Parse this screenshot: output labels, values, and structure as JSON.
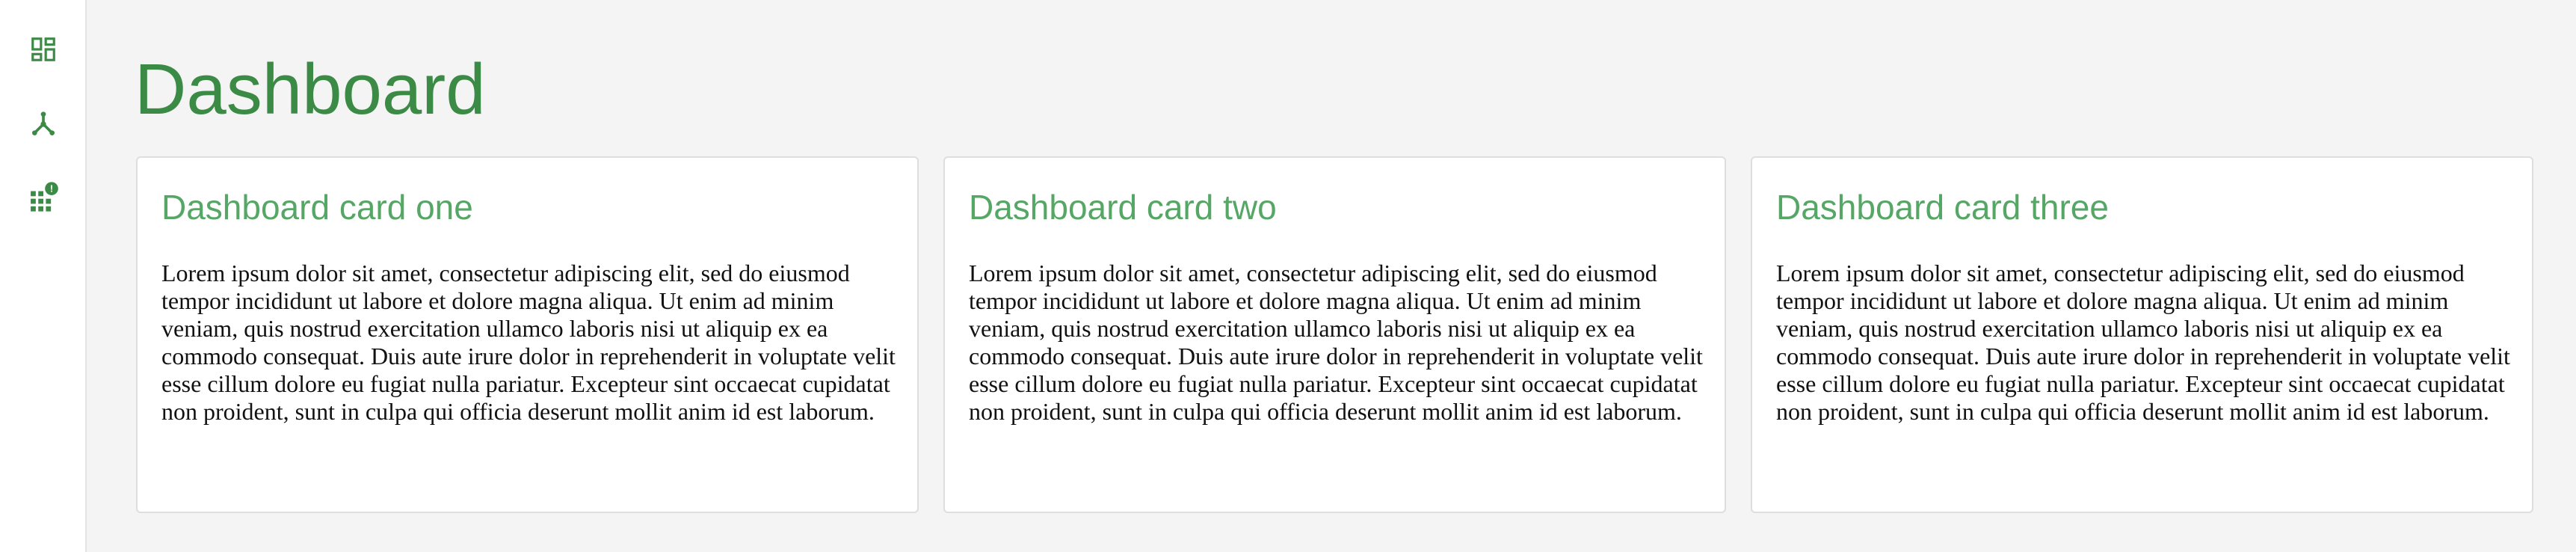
{
  "sidebar": {
    "items": [
      {
        "icon": "dashboard-icon",
        "label": ""
      },
      {
        "icon": "hub-icon",
        "label": ""
      },
      {
        "icon": "apps-notification-icon",
        "label": "",
        "badge": "!"
      }
    ]
  },
  "colors": {
    "accent": "#3b8a45",
    "card_title": "#56a666",
    "background": "#f4f4f4",
    "card_background": "#ffffff"
  },
  "page": {
    "title": "Dashboard"
  },
  "cards": [
    {
      "title": "Dashboard card one",
      "body": "Lorem ipsum dolor sit amet, consectetur adipiscing elit, sed do eiusmod tempor incididunt ut labore et dolore magna aliqua. Ut enim ad minim veniam, quis nostrud exercitation ullamco laboris nisi ut aliquip ex ea commodo consequat. Duis aute irure dolor in reprehenderit in voluptate velit esse cillum dolore eu fugiat nulla pariatur. Excepteur sint occaecat cupidatat non proident, sunt in culpa qui officia deserunt mollit anim id est laborum."
    },
    {
      "title": "Dashboard card two",
      "body": "Lorem ipsum dolor sit amet, consectetur adipiscing elit, sed do eiusmod tempor incididunt ut labore et dolore magna aliqua. Ut enim ad minim veniam, quis nostrud exercitation ullamco laboris nisi ut aliquip ex ea commodo consequat. Duis aute irure dolor in reprehenderit in voluptate velit esse cillum dolore eu fugiat nulla pariatur. Excepteur sint occaecat cupidatat non proident, sunt in culpa qui officia deserunt mollit anim id est laborum."
    },
    {
      "title": "Dashboard card three",
      "body": "Lorem ipsum dolor sit amet, consectetur adipiscing elit, sed do eiusmod tempor incididunt ut labore et dolore magna aliqua. Ut enim ad minim veniam, quis nostrud exercitation ullamco laboris nisi ut aliquip ex ea commodo consequat. Duis aute irure dolor in reprehenderit in voluptate velit esse cillum dolore eu fugiat nulla pariatur. Excepteur sint occaecat cupidatat non proident, sunt in culpa qui officia deserunt mollit anim id est laborum."
    }
  ]
}
